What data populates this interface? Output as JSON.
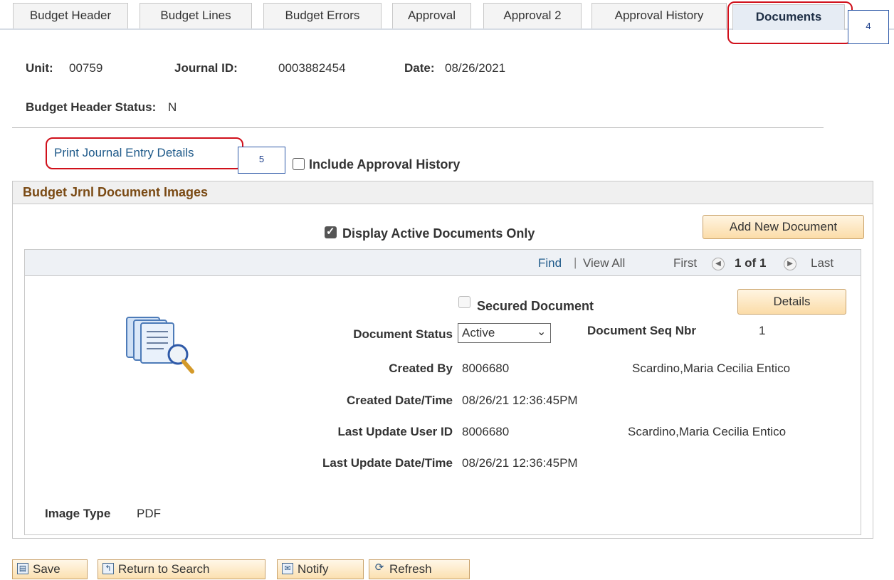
{
  "tabs": [
    {
      "label": "Budget Header"
    },
    {
      "label": "Budget Lines"
    },
    {
      "label": "Budget Errors"
    },
    {
      "label": "Approval"
    },
    {
      "label": "Approval 2"
    },
    {
      "label": "Approval History"
    },
    {
      "label": "Documents",
      "active": true
    }
  ],
  "callouts": {
    "tab": "4",
    "print": "5"
  },
  "header": {
    "unit_label": "Unit:",
    "unit_value": "00759",
    "journal_label": "Journal ID:",
    "journal_value": "0003882454",
    "date_label": "Date:",
    "date_value": "08/26/2021",
    "status_label": "Budget Header Status:",
    "status_value": "N"
  },
  "print_link": "Print Journal Entry Details",
  "include_approval": {
    "label": "Include Approval History",
    "checked": false
  },
  "panel": {
    "title": "Budget Jrnl Document Images",
    "display_active": {
      "label": "Display Active Documents Only",
      "checked": true
    },
    "add_button": "Add New Document",
    "nav": {
      "find": "Find",
      "sep": "|",
      "view_all": "View All",
      "first": "First",
      "count": "1 of 1",
      "last": "Last"
    }
  },
  "document": {
    "secured": {
      "label": "Secured Document",
      "checked": false
    },
    "details_button": "Details",
    "status_label": "Document Status",
    "status_value": "Active",
    "seq_label": "Document Seq Nbr",
    "seq_value": "1",
    "created_by_label": "Created By",
    "created_by_id": "8006680",
    "created_by_name": "Scardino,Maria Cecilia Entico",
    "created_dt_label": "Created Date/Time",
    "created_dt_value": "08/26/21 12:36:45PM",
    "updated_by_label": "Last Update User ID",
    "updated_by_id": "8006680",
    "updated_by_name": "Scardino,Maria Cecilia Entico",
    "updated_dt_label": "Last Update Date/Time",
    "updated_dt_value": "08/26/21 12:36:45PM",
    "image_type_label": "Image Type",
    "image_type_value": "PDF"
  },
  "footer": {
    "save": "Save",
    "return": "Return to Search",
    "notify": "Notify",
    "refresh": "Refresh"
  }
}
